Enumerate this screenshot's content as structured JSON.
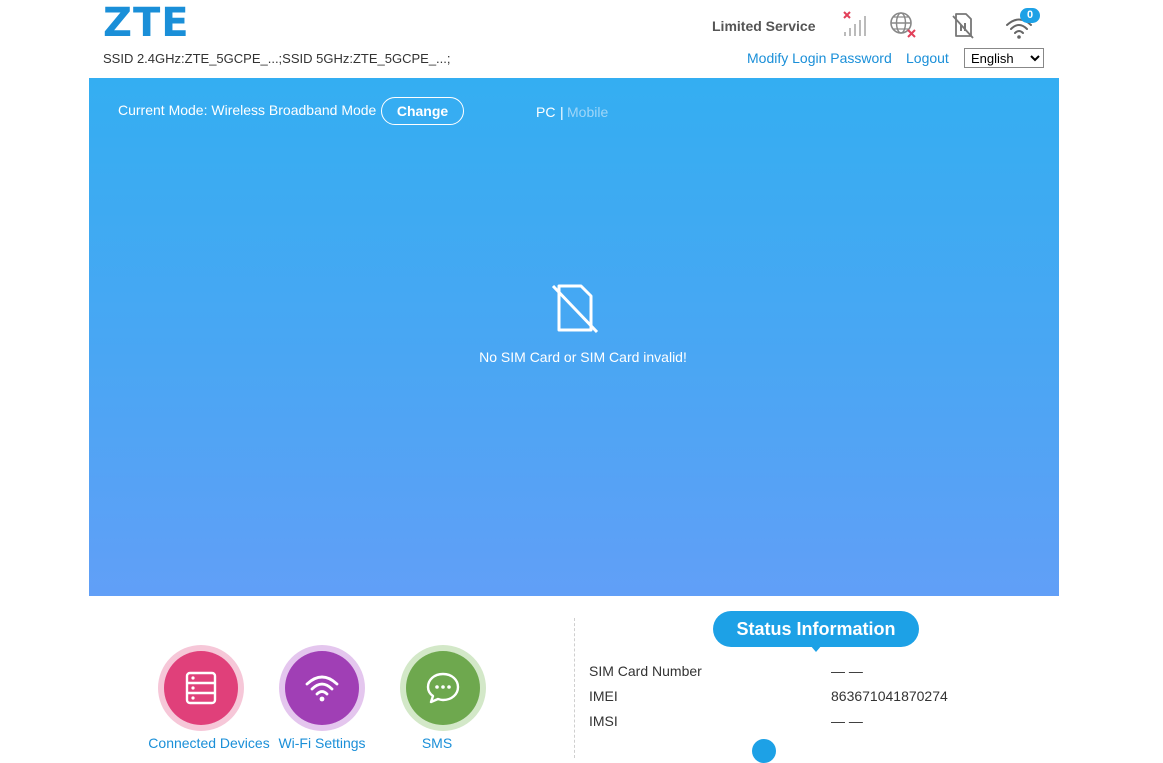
{
  "brand": {
    "logo": "ZTE"
  },
  "header": {
    "ssid_text": "SSID 2.4GHz:ZTE_5GCPE_...;SSID 5GHz:ZTE_5GCPE_...;",
    "network_status": "Limited Service",
    "wifi_clients_count": "0",
    "modify_password_label": "Modify Login Password",
    "logout_label": "Logout",
    "language": {
      "selected": "English"
    },
    "icons": [
      "signal-no-service-icon",
      "internet-disconnected-icon",
      "no-sim-icon",
      "wifi-icon"
    ]
  },
  "banner": {
    "mode_text": "Current Mode: Wireless Broadband Mode",
    "change_label": "Change",
    "pc_label": "PC",
    "separator": "|",
    "mobile_label": "Mobile",
    "sim_message": "No SIM Card or SIM Card invalid!"
  },
  "quick_access": [
    {
      "label": "Connected Devices",
      "icon": "device-list-icon",
      "color": "#e0407a"
    },
    {
      "label": "Wi-Fi Settings",
      "icon": "wifi-settings-icon",
      "color": "#a03fb5"
    },
    {
      "label": "SMS",
      "icon": "sms-icon",
      "color": "#6ea84e"
    }
  ],
  "status_info": {
    "title": "Status Information",
    "rows": [
      {
        "label": "SIM Card Number",
        "value": "— —"
      },
      {
        "label": "IMEI",
        "value": "863671041870274"
      },
      {
        "label": "IMSI",
        "value": "— —"
      }
    ]
  },
  "colors": {
    "accent": "#1da1e6",
    "link": "#1a8fd8",
    "banner_top": "#34aef2",
    "banner_bottom": "#619ff7"
  }
}
